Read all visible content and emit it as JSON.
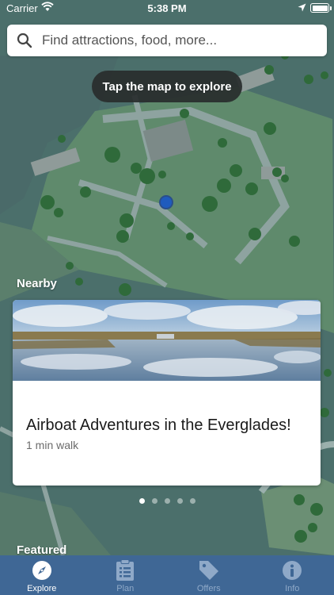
{
  "status_bar": {
    "carrier": "Carrier",
    "time": "5:38 PM"
  },
  "search": {
    "placeholder": "Find attractions, food, more..."
  },
  "map_hint": "Tap the map to explore",
  "nearby": {
    "label": "Nearby",
    "card": {
      "title": "Airboat Adventures in the Everglades!",
      "subtitle": "1 min walk"
    },
    "page_count": 5,
    "active_page": 1
  },
  "featured": {
    "label": "Featured"
  },
  "tabs": [
    {
      "label": "Explore",
      "icon": "compass-icon",
      "active": true
    },
    {
      "label": "Plan",
      "icon": "clipboard-icon",
      "active": false
    },
    {
      "label": "Offers",
      "icon": "tag-icon",
      "active": false
    },
    {
      "label": "Info",
      "icon": "info-icon",
      "active": false
    }
  ],
  "colors": {
    "tab_bar": "#3f6795",
    "map_water": "#4a6c6a",
    "map_land": "#6b8e74",
    "location_dot": "#1f5bbd"
  }
}
